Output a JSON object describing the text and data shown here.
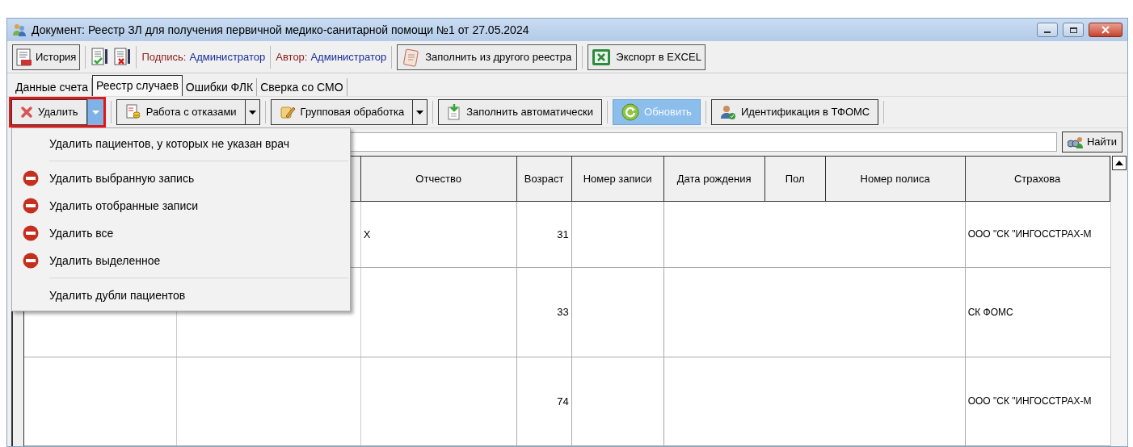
{
  "window": {
    "title": "Документ: Реестр ЗЛ для получения первичной медико-санитарной помощи №1 от 27.05.2024"
  },
  "top_toolbar": {
    "history_button": "История",
    "sign": {
      "label": "Подпись:",
      "value": "Администратор"
    },
    "author": {
      "label": "Автор:",
      "value": "Администратор"
    },
    "fill_button": "Заполнить из другого реестра",
    "export_button": "Экспорт в EXCEL"
  },
  "tabs": [
    {
      "label": "Данные счета",
      "selected": false
    },
    {
      "label": "Реестр случаев",
      "selected": true
    },
    {
      "label": "Ошибки ФЛК",
      "selected": false
    },
    {
      "label": "Сверка со СМО",
      "selected": false
    }
  ],
  "actions": [
    {
      "kind": "delete",
      "label": "Удалить",
      "split": true,
      "open": true,
      "hovered": false
    },
    {
      "kind": "refusals",
      "label": "Работа с отказами",
      "split": true,
      "open": false,
      "hovered": false
    },
    {
      "kind": "group",
      "label": "Групповая обработка",
      "split": true,
      "open": false,
      "hovered": false
    },
    {
      "kind": "autofill",
      "label": "Заполнить автоматически",
      "split": false,
      "open": false,
      "hovered": false
    },
    {
      "kind": "refresh",
      "label": "Обновить",
      "split": false,
      "open": false,
      "hovered": true
    },
    {
      "kind": "identify",
      "label": "Идентификация в ТФОМС",
      "split": false,
      "open": false,
      "hovered": false
    }
  ],
  "search": {
    "button": "Найти"
  },
  "table": {
    "columns": [
      "Отчество",
      "Возраст",
      "Номер записи",
      "Дата рождения",
      "Пол",
      "Номер полиса",
      "Страхова"
    ],
    "rows": [
      {
        "patronymic": "Х",
        "age": "31",
        "insurer": "ООО \"СК \"ИНГОССТРАХ-М"
      },
      {
        "patronymic": "",
        "age": "33",
        "insurer": "СК ФОМС"
      },
      {
        "patronymic": "",
        "age": "74",
        "insurer": "ООО \"СК \"ИНГОССТРАХ-М"
      }
    ]
  },
  "menu": [
    {
      "kind": "plain",
      "label": "Удалить пациентов, у которых не указан врач"
    },
    {
      "kind": "separator"
    },
    {
      "kind": "icon",
      "label": "Удалить выбранную запись"
    },
    {
      "kind": "icon",
      "label": "Удалить отобранные записи"
    },
    {
      "kind": "icon",
      "label": "Удалить все"
    },
    {
      "kind": "icon",
      "label": "Удалить выделенное"
    },
    {
      "kind": "separator"
    },
    {
      "kind": "plain",
      "label": "Удалить дубли пациентов"
    }
  ]
}
